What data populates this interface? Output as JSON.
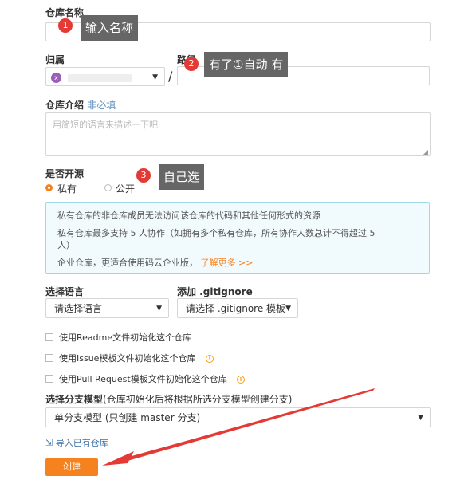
{
  "form": {
    "name_label": "仓库名称",
    "owner_label": "归属",
    "owner_value_initial": "x",
    "separator": "/",
    "path_label": "路径",
    "desc_label": "仓库介绍",
    "desc_optional": "非必填",
    "desc_placeholder": "用简短的语言来描述一下吧",
    "visibility_label": "是否开源",
    "private_label": "私有",
    "public_label": "公开",
    "info_line1": "私有仓库的非仓库成员无法访问该仓库的代码和其他任何形式的资源",
    "info_line2": "私有仓库最多支持 5 人协作（如拥有多个私有仓库，所有协作人数总计不得超过 5",
    "info_line3": "人）",
    "info_line4": "企业仓库，更适合使用码云企业版，",
    "info_link": "了解更多 >>",
    "language_label": "选择语言",
    "language_value": "请选择语言",
    "gitignore_label": "添加 .gitignore",
    "gitignore_value": "请选择 .gitignore 模板",
    "readme_label": "使用Readme文件初始化这个仓库",
    "issue_label": "使用Issue模板文件初始化这个仓库",
    "pr_label": "使用Pull Request模板文件初始化这个仓库",
    "branch_label": "选择分支模型",
    "branch_hint": "(仓库初始化后将根据所选分支模型创建分支)",
    "branch_value": "单分支模型 (只创建 master 分支)",
    "import_label": "导入已有仓库",
    "create_button": "创建"
  },
  "annotations": {
    "tip1": "输入名称",
    "tip2": "有了①自动 有",
    "tip3": "自己选",
    "n1": "1",
    "n2": "2",
    "n3": "3"
  },
  "colors": {
    "accent": "#f6821f",
    "link": "#f6821f",
    "info_border": "#9fd8e7",
    "annotation_badge": "#e53935",
    "annotation_arrow": "#e53935"
  }
}
